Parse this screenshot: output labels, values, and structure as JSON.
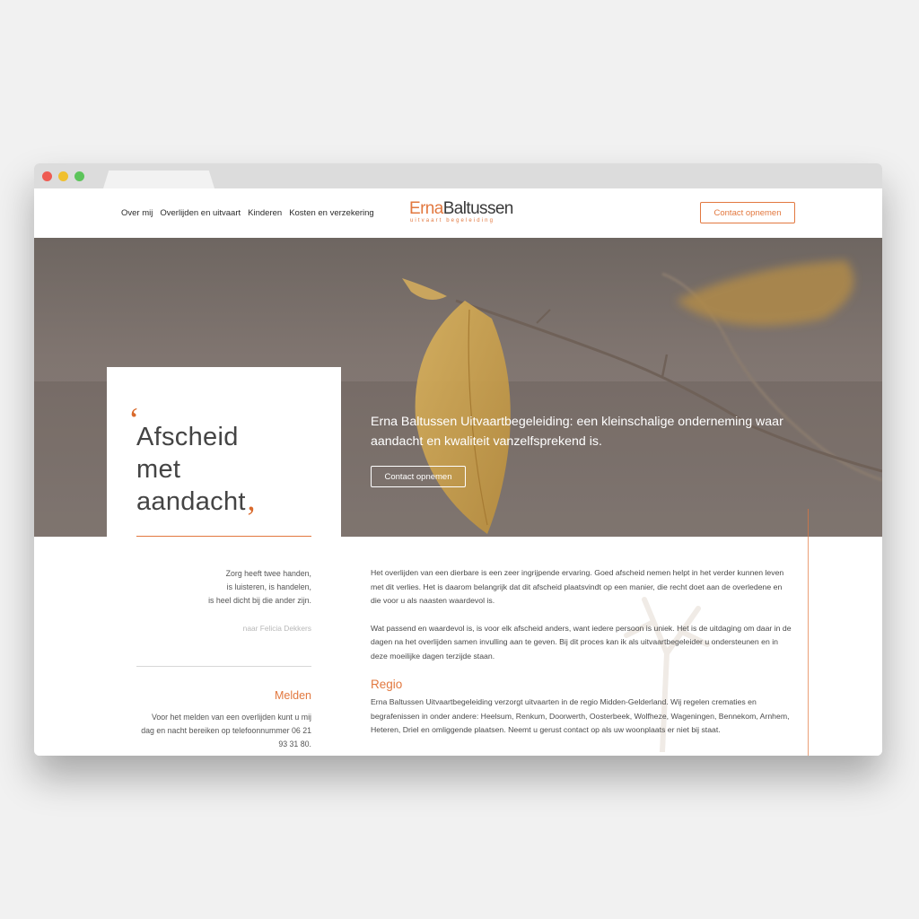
{
  "nav": {
    "items": [
      "Over mij",
      "Overlijden en uitvaart",
      "Kinderen",
      "Kosten en verzekering"
    ]
  },
  "logo": {
    "first": "Erna",
    "last": "Baltussen",
    "sub": "uitvaart begeleiding"
  },
  "header": {
    "cta": "Contact opnemen"
  },
  "hero": {
    "text": "Erna Baltussen Uitvaartbegeleiding: een kleinschalige onderneming waar aandacht en kwaliteit vanzelfsprekend is.",
    "cta": "Contact opnemen",
    "quote_open": "‘",
    "quote_lines": [
      "Afscheid",
      "met",
      "aandacht"
    ],
    "quote_close": "‚"
  },
  "sidebar": {
    "poem": [
      "Zorg heeft twee handen,",
      "is luisteren, is handelen,",
      "is heel dicht bij die ander zijn."
    ],
    "poem_author": "naar Felicia Dekkers",
    "melden_title": "Melden",
    "melden_text": "Voor het melden van een overlijden kunt u mij dag en nacht bereiken op telefoonnummer 06 21 93 31 80."
  },
  "main": {
    "paragraph1": "Het overlijden van een dierbare is een zeer ingrijpende ervaring. Goed afscheid nemen helpt in het verder kunnen leven met dit verlies. Het is daarom belangrijk dat dit afscheid plaatsvindt op een manier, die recht doet aan de overledene en die voor u als naasten waardevol is.",
    "paragraph2": "Wat passend en waardevol is, is voor elk afscheid anders, want iedere persoon is uniek. Het is de uitdaging om daar in de dagen na het overlijden samen invulling aan te geven. Bij dit proces kan ik als uitvaartbegeleider u ondersteunen en in deze moeilijke dagen terzijde staan.",
    "region_title": "Regio",
    "region_text": "Erna Baltussen Uitvaartbegeleiding verzorgt uitvaarten in de regio Midden-Gelderland. Wij regelen crematies en begrafenissen in onder andere: Heelsum, Renkum, Doorwerth, Oosterbeek, Wolfheze, Wageningen, Bennekom, Arnhem, Heteren, Driel en omliggende plaatsen. Neemt u gerust contact op als uw woonplaats er niet bij staat."
  },
  "colors": {
    "accent": "#e2783f",
    "background": "#f1f1f1",
    "chrome": "#dcdcdc"
  },
  "icons": [
    "window-close-dot",
    "window-minimize-dot",
    "window-maximize-dot",
    "quote-mark-icon"
  ]
}
